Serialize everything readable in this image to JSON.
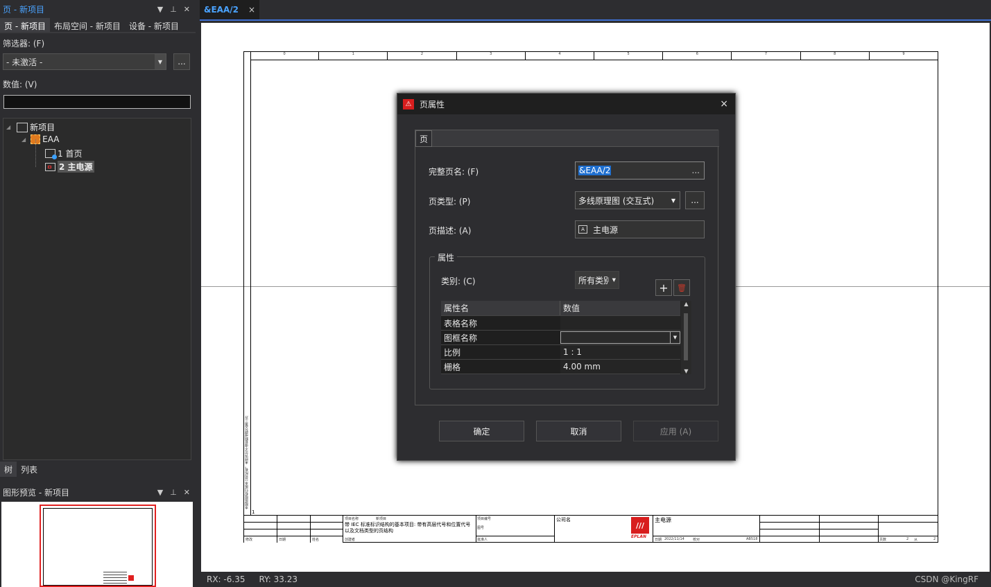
{
  "left_panel": {
    "title": "页 - 新项目",
    "tabs": [
      "页 - 新项目",
      "布局空间 - 新项目",
      "设备 - 新项目"
    ],
    "filter_label": "筛选器: (F)",
    "filter_value": "- 未激活 -",
    "more_button": "...",
    "value_label": "数值: (V)",
    "value_input": "",
    "tree": {
      "root": "新项目",
      "child": "EAA",
      "pages": [
        "1 首页",
        "2 主电源"
      ]
    },
    "bottom_tabs": [
      "树",
      "列表"
    ],
    "preview_title": "图形预览 - 新项目"
  },
  "document": {
    "tab_label": "&EAA/2",
    "tab_close": "×",
    "status_rx": "RX: -6.35",
    "status_ry": "RY: 33.23",
    "watermark": "CSDN @KingRF",
    "column_numbers": [
      "0",
      "1",
      "2",
      "3",
      "4",
      "5",
      "6",
      "7",
      "8",
      "9"
    ],
    "row_marker": "1",
    "title_block": {
      "project_name_label": "项目名称",
      "project_name": "新项目",
      "description": "带 IEC 标准标识结构的基本项目: 带有高层代号和位置代号以及文档类型的页结构",
      "company_label": "公司名",
      "page_desc": "主电源",
      "logo_text": "EPLAN",
      "date_label": "日期",
      "date": "2022/11/14",
      "page_label": "页数",
      "page_value": "2",
      "from_label": "从",
      "from_value": "2",
      "created_label": "创建者",
      "changed_label": "修改",
      "name_label": "姓名",
      "checked_label": "校对",
      "approved_label": "批准人",
      "project_code_label": "项目编号",
      "drawing_no_label": "图号",
      "small_code": "AB518",
      "side_text": "本图纸版权归属本公司所有，未经许可不得复制或转交第三方"
    }
  },
  "dialog": {
    "title": "页属性",
    "close": "×",
    "tab": "页",
    "full_page_label": "完整页名: (F)",
    "full_page_value": "&EAA/2",
    "full_page_button": "...",
    "page_type_label": "页类型: (P)",
    "page_type_value": "多线原理图 (交互式)",
    "page_type_button": "...",
    "page_desc_label": "页描述: (A)",
    "page_desc_value": "主电源",
    "group_label": "属性",
    "category_label": "类别: (C)",
    "category_value": "所有类别",
    "add_icon": "+",
    "delete_icon": "🗑",
    "grid_headers": [
      "属性名",
      "数值"
    ],
    "grid_rows": [
      {
        "name": "表格名称",
        "value": ""
      },
      {
        "name": "图框名称",
        "value": ""
      },
      {
        "name": "比例",
        "value": "1 : 1"
      },
      {
        "name": "栅格",
        "value": "4.00 mm"
      }
    ],
    "ok_button": "确定",
    "cancel_button": "取消",
    "apply_button": "应用 (A)"
  }
}
